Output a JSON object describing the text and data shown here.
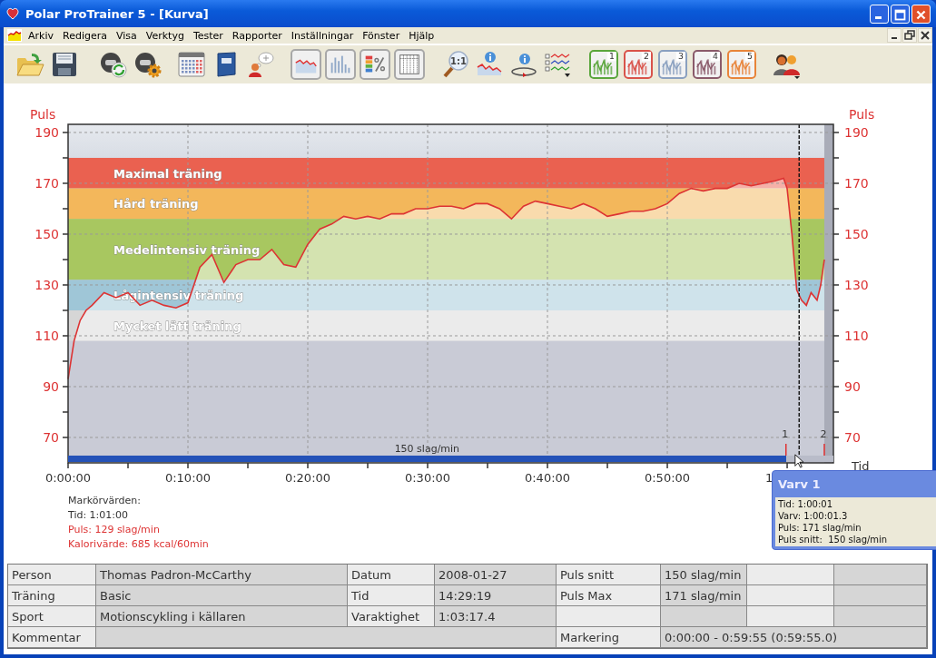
{
  "window": {
    "title": "Polar ProTrainer 5 - [Kurva]"
  },
  "menu": [
    "Arkiv",
    "Redigera",
    "Visa",
    "Verktyg",
    "Tester",
    "Rapporter",
    "Inställningar",
    "Fönster",
    "Hjälp"
  ],
  "toolbar": {
    "zoom_label": "1:1",
    "lap_views": [
      {
        "label": "1",
        "color": "#5aa63c"
      },
      {
        "label": "2",
        "color": "#d9534a"
      },
      {
        "label": "3",
        "color": "#8aa0c0"
      },
      {
        "label": "4",
        "color": "#8a5a6a"
      },
      {
        "label": "5",
        "color": "#e8843a"
      }
    ]
  },
  "chart_data": {
    "type": "area",
    "ylabel": "Puls",
    "y2label": "Puls",
    "xlabel": "Tid",
    "grid": true,
    "ylim": [
      60,
      193.2
    ],
    "y2lim": [
      60,
      193.2
    ],
    "xlim": [
      0,
      63.86
    ],
    "yticks": [
      70,
      90,
      110,
      130,
      150,
      170,
      190
    ],
    "y2ticks": [
      70,
      90,
      110,
      130,
      150,
      170,
      190
    ],
    "xticks": [
      {
        "value": 0,
        "label": "0:00:00"
      },
      {
        "value": 10,
        "label": "0:10:00"
      },
      {
        "value": 20,
        "label": "0:20:00"
      },
      {
        "value": 30,
        "label": "0:30:00"
      },
      {
        "value": 40,
        "label": "0:40:00"
      },
      {
        "value": 50,
        "label": "0:50:00"
      }
    ],
    "x": [
      0,
      0.5,
      1,
      1.5,
      2,
      3,
      4,
      5,
      6,
      7,
      8,
      9,
      10,
      11,
      12,
      13,
      14,
      15,
      16,
      17,
      18,
      19,
      20,
      21,
      22,
      23,
      24,
      25,
      26,
      27,
      28,
      29,
      30,
      31,
      32,
      33,
      34,
      35,
      36,
      37,
      38,
      39,
      40,
      41,
      42,
      43,
      44,
      45,
      46,
      47,
      48,
      49,
      50,
      51,
      52,
      53,
      54,
      55,
      56,
      57,
      58,
      59,
      59.7,
      60,
      60.4,
      60.8,
      61.2,
      61.6,
      62,
      62.5,
      62.8,
      63.1
    ],
    "series": [
      {
        "color": "#dd3333",
        "values": [
          93,
          108,
          116,
          120,
          122,
          127,
          125,
          127,
          122,
          124,
          122,
          121,
          123,
          137,
          142,
          131,
          138,
          140,
          140,
          144,
          138,
          137,
          146,
          152,
          154,
          157,
          156,
          157,
          156,
          158,
          158,
          160,
          160,
          161,
          161,
          160,
          162,
          162,
          160,
          156,
          161,
          163,
          162,
          161,
          160,
          162,
          160,
          157,
          158,
          159,
          159,
          160,
          162,
          166,
          168,
          167,
          168,
          168,
          170,
          169,
          170,
          171,
          172,
          168,
          150,
          128,
          124,
          122,
          127,
          124,
          130,
          140
        ]
      }
    ],
    "bands": [
      {
        "axis": "y",
        "from": 168,
        "to": 180,
        "label": "Maximal träning",
        "color": "#ea6150"
      },
      {
        "axis": "y",
        "from": 156,
        "to": 168,
        "label": "Hård träning",
        "color": "#f3b75b"
      },
      {
        "axis": "y",
        "from": 132,
        "to": 156,
        "label": "Medelintensiv träning",
        "color": "#a8c760"
      },
      {
        "axis": "y",
        "from": 120,
        "to": 132,
        "label": "Lågintensiv träning",
        "color": "#9fc6d7"
      },
      {
        "axis": "y",
        "from": 108,
        "to": 120,
        "label": "Mycket lätt träning",
        "color": "#d6d6d6"
      },
      {
        "axis": "x",
        "from": 63.1,
        "to": 63.86,
        "color": "#a9acb8"
      }
    ],
    "ref_lines": [
      {
        "axis": "x",
        "value": 61,
        "color": "#111111"
      }
    ]
  },
  "lap_bar": {
    "label": "150 slag/min",
    "level": 0.938
  },
  "lap_numbers": [
    "1",
    "2"
  ],
  "axis_fragment": "1",
  "marker_values": [
    {
      "text": "Markörvärden:",
      "color": "#333333"
    },
    {
      "text": "Tid: 1:01:00",
      "color": "#333333"
    },
    {
      "text": "Puls: 129 slag/min",
      "color": "#dd3333"
    },
    {
      "text": "Kalorivärde: 685 kcal/60min",
      "color": "#dd3333"
    }
  ],
  "tooltip": {
    "title": "Varv 1",
    "lines": [
      "Tid: 1:00:01",
      "Varv: 1:00:01.3",
      "Puls: 171 slag/min",
      "Puls snitt:  150 slag/min"
    ]
  },
  "info_table": {
    "rows": [
      [
        {
          "kind": "label",
          "text": "Person"
        },
        {
          "kind": "value",
          "text": "Thomas Padron-McCarthy"
        },
        {
          "kind": "label",
          "text": "Datum"
        },
        {
          "kind": "value",
          "text": "2008-01-27"
        },
        {
          "kind": "label",
          "text": "Puls snitt"
        },
        {
          "kind": "value",
          "text": "150 slag/min"
        },
        {
          "kind": "label",
          "text": ""
        },
        {
          "kind": "value",
          "text": ""
        }
      ],
      [
        {
          "kind": "label",
          "text": "Träning"
        },
        {
          "kind": "value",
          "text": "Basic"
        },
        {
          "kind": "label",
          "text": "Tid"
        },
        {
          "kind": "value",
          "text": "14:29:19"
        },
        {
          "kind": "label",
          "text": "Puls Max"
        },
        {
          "kind": "value",
          "text": "171 slag/min"
        },
        {
          "kind": "label",
          "text": ""
        },
        {
          "kind": "value",
          "text": ""
        }
      ],
      [
        {
          "kind": "label",
          "text": "Sport"
        },
        {
          "kind": "value",
          "text": "Motionscykling i källaren"
        },
        {
          "kind": "label",
          "text": "Varaktighet"
        },
        {
          "kind": "value",
          "text": "1:03:17.4"
        },
        {
          "kind": "label",
          "text": ""
        },
        {
          "kind": "value",
          "text": ""
        },
        {
          "kind": "label",
          "text": ""
        },
        {
          "kind": "value",
          "text": ""
        }
      ],
      [
        {
          "kind": "label",
          "text": "Kommentar"
        },
        {
          "kind": "value",
          "text": ""
        },
        {
          "kind": "merged",
          "text": ""
        },
        {
          "kind": "merged",
          "text": ""
        },
        {
          "kind": "label",
          "text": "Markering"
        },
        {
          "kind": "value",
          "text": "0:00:00 - 0:59:55 (0:59:55.0)"
        },
        {
          "kind": "merged",
          "text": ""
        },
        {
          "kind": "merged",
          "text": ""
        }
      ]
    ]
  }
}
